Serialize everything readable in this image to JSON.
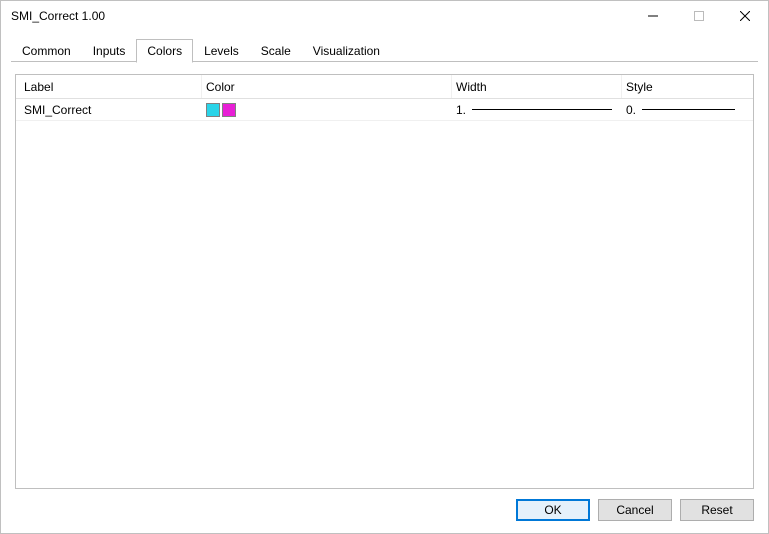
{
  "window": {
    "title": "SMI_Correct 1.00"
  },
  "tabs": [
    {
      "label": "Common",
      "active": false
    },
    {
      "label": "Inputs",
      "active": false
    },
    {
      "label": "Colors",
      "active": true
    },
    {
      "label": "Levels",
      "active": false
    },
    {
      "label": "Scale",
      "active": false
    },
    {
      "label": "Visualization",
      "active": false
    }
  ],
  "table": {
    "headers": {
      "label": "Label",
      "color": "Color",
      "width": "Width",
      "style": "Style"
    },
    "rows": [
      {
        "label": "SMI_Correct",
        "colors": [
          "#2ad4e8",
          "#e81fd6"
        ],
        "width": "1.",
        "style": "0."
      }
    ]
  },
  "buttons": {
    "ok": "OK",
    "cancel": "Cancel",
    "reset": "Reset"
  }
}
